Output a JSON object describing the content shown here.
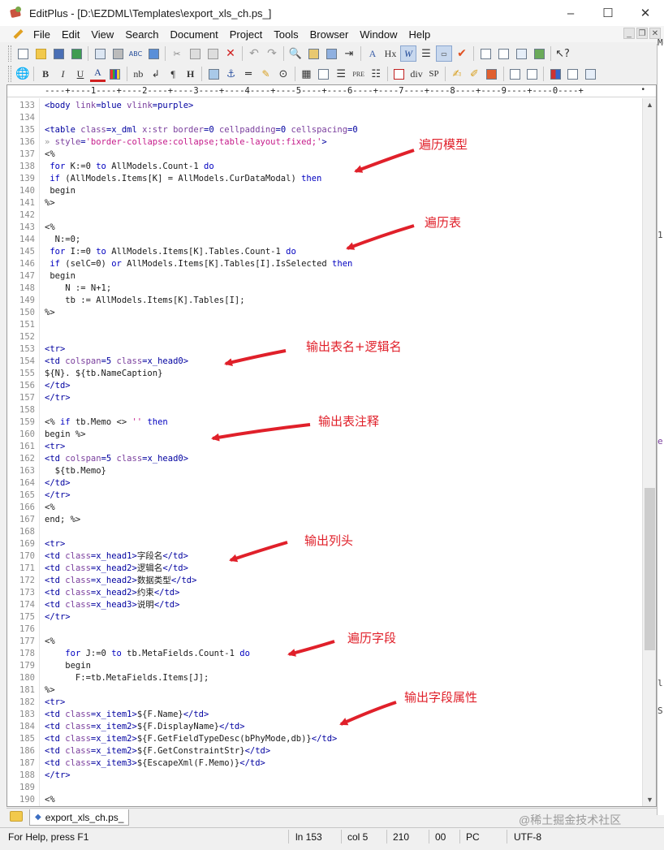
{
  "window": {
    "title": "EditPlus - [D:\\EZDML\\Templates\\export_xls_ch.ps_]"
  },
  "window_buttons": {
    "minimize": "–",
    "maximize": "☐",
    "close": "✕"
  },
  "menu": [
    "File",
    "Edit",
    "View",
    "Search",
    "Document",
    "Project",
    "Tools",
    "Browser",
    "Window",
    "Help"
  ],
  "mdi_buttons": [
    "_",
    "❐",
    "✕"
  ],
  "toolbar2_text": {
    "bold": "B",
    "italic": "I",
    "underline": "U",
    "font_color": "A",
    "nbsp": "nb",
    "paragraph": "¶",
    "heading": "H",
    "pre": "PRE",
    "div": "div",
    "span": "SP"
  },
  "toolbar1_text": {
    "hx": "Hx",
    "w": "W",
    "spell": "ABC"
  },
  "ruler": "----+----1----+----2----+----3----+----4----+----5----+----6----+----7----+----8----+----9----+----0----+",
  "right_strip_chars": [
    "1",
    "e",
    "l",
    "S",
    "M"
  ],
  "colors": {
    "tag": "#0000a0",
    "attr": "#7a3e9d",
    "value": "#c51b8a",
    "keyword": "#0000c0",
    "annotation": "#e0202a"
  },
  "code_lines": [
    {
      "n": "133",
      "t": [
        [
          "<body ",
          "tag"
        ],
        [
          "link",
          "attr"
        ],
        [
          "=blue ",
          "tag"
        ],
        [
          "vlink",
          "attr"
        ],
        [
          "=purple>",
          "tag"
        ]
      ]
    },
    {
      "n": "134",
      "t": []
    },
    {
      "n": "135",
      "t": [
        [
          "<table ",
          "tag"
        ],
        [
          "class",
          "attr"
        ],
        [
          "=x_dml ",
          "tag"
        ],
        [
          "x:str ",
          "attr"
        ],
        [
          "border",
          "attr"
        ],
        [
          "=0 ",
          "tag"
        ],
        [
          "cellpadding",
          "attr"
        ],
        [
          "=0 ",
          "tag"
        ],
        [
          "cellspacing",
          "attr"
        ],
        [
          "=0",
          "tag"
        ]
      ]
    },
    {
      "n": "136",
      "t": [
        [
          "» ",
          "gray"
        ],
        [
          "style",
          "attr"
        ],
        [
          "=",
          "tag"
        ],
        [
          "'border-collapse:collapse;table-layout:fixed;'",
          "value"
        ],
        [
          ">",
          "tag"
        ]
      ]
    },
    {
      "n": "137",
      "t": [
        [
          "<%",
          "dark"
        ]
      ]
    },
    {
      "n": "138",
      "t": [
        [
          " ",
          "dark"
        ],
        [
          "for ",
          "keyword"
        ],
        [
          "K:=0 ",
          "dark"
        ],
        [
          "to ",
          "keyword"
        ],
        [
          "AllModels.Count-1 ",
          "dark"
        ],
        [
          "do",
          "keyword"
        ]
      ]
    },
    {
      "n": "139",
      "t": [
        [
          " ",
          "dark"
        ],
        [
          "if ",
          "keyword"
        ],
        [
          "(AllModels.Items[K] = AllModels.CurDataModal) ",
          "dark"
        ],
        [
          "then",
          "keyword"
        ]
      ]
    },
    {
      "n": "140",
      "t": [
        [
          " begin",
          "dark"
        ]
      ]
    },
    {
      "n": "141",
      "t": [
        [
          "%>",
          "dark"
        ]
      ]
    },
    {
      "n": "142",
      "t": []
    },
    {
      "n": "143",
      "t": [
        [
          "<%",
          "dark"
        ]
      ]
    },
    {
      "n": "144",
      "t": [
        [
          "  N:=0;",
          "dark"
        ]
      ]
    },
    {
      "n": "145",
      "t": [
        [
          " ",
          "dark"
        ],
        [
          "for ",
          "keyword"
        ],
        [
          "I:=0 ",
          "dark"
        ],
        [
          "to ",
          "keyword"
        ],
        [
          "AllModels.Items[K].Tables.Count-1 ",
          "dark"
        ],
        [
          "do",
          "keyword"
        ]
      ]
    },
    {
      "n": "146",
      "t": [
        [
          " ",
          "dark"
        ],
        [
          "if ",
          "keyword"
        ],
        [
          "(selC=0) ",
          "dark"
        ],
        [
          "or ",
          "keyword"
        ],
        [
          "AllModels.Items[K].Tables[I].IsSelected ",
          "dark"
        ],
        [
          "then",
          "keyword"
        ]
      ]
    },
    {
      "n": "147",
      "t": [
        [
          " begin",
          "dark"
        ]
      ]
    },
    {
      "n": "148",
      "t": [
        [
          "    N := N+1;",
          "dark"
        ]
      ]
    },
    {
      "n": "149",
      "t": [
        [
          "    tb := AllModels.Items[K].Tables[I];",
          "dark"
        ]
      ]
    },
    {
      "n": "150",
      "t": [
        [
          "%>",
          "dark"
        ]
      ]
    },
    {
      "n": "151",
      "t": []
    },
    {
      "n": "152",
      "t": []
    },
    {
      "n": "153",
      "t": [
        [
          "<tr>",
          "tag"
        ]
      ]
    },
    {
      "n": "154",
      "t": [
        [
          "<td ",
          "tag"
        ],
        [
          "colspan",
          "attr"
        ],
        [
          "=5 ",
          "tag"
        ],
        [
          "class",
          "attr"
        ],
        [
          "=x_head0>",
          "tag"
        ]
      ]
    },
    {
      "n": "155",
      "t": [
        [
          "${N}. ${tb.NameCaption}",
          "dark"
        ]
      ]
    },
    {
      "n": "156",
      "t": [
        [
          "</td>",
          "tag"
        ]
      ]
    },
    {
      "n": "157",
      "t": [
        [
          "</tr>",
          "tag"
        ]
      ]
    },
    {
      "n": "158",
      "t": []
    },
    {
      "n": "159",
      "t": [
        [
          "<% ",
          "dark"
        ],
        [
          "if ",
          "keyword"
        ],
        [
          "tb.Memo <> ",
          "dark"
        ],
        [
          "'' ",
          "value"
        ],
        [
          "then",
          "keyword"
        ]
      ]
    },
    {
      "n": "160",
      "t": [
        [
          "begin %>",
          "dark"
        ]
      ]
    },
    {
      "n": "161",
      "t": [
        [
          "<tr>",
          "tag"
        ]
      ]
    },
    {
      "n": "162",
      "t": [
        [
          "<td ",
          "tag"
        ],
        [
          "colspan",
          "attr"
        ],
        [
          "=5 ",
          "tag"
        ],
        [
          "class",
          "attr"
        ],
        [
          "=x_head0>",
          "tag"
        ]
      ]
    },
    {
      "n": "163",
      "t": [
        [
          "  ${tb.Memo}",
          "dark"
        ]
      ]
    },
    {
      "n": "164",
      "t": [
        [
          "</td>",
          "tag"
        ]
      ]
    },
    {
      "n": "165",
      "t": [
        [
          "</tr>",
          "tag"
        ]
      ]
    },
    {
      "n": "166",
      "t": [
        [
          "<%",
          "dark"
        ]
      ]
    },
    {
      "n": "167",
      "t": [
        [
          "end; %>",
          "dark"
        ]
      ]
    },
    {
      "n": "168",
      "t": []
    },
    {
      "n": "169",
      "t": [
        [
          "<tr>",
          "tag"
        ]
      ]
    },
    {
      "n": "170",
      "t": [
        [
          "<td ",
          "tag"
        ],
        [
          "class",
          "attr"
        ],
        [
          "=x_head1>",
          "tag"
        ],
        [
          "字段名",
          "dark"
        ],
        [
          "</td>",
          "tag"
        ]
      ]
    },
    {
      "n": "171",
      "t": [
        [
          "<td ",
          "tag"
        ],
        [
          "class",
          "attr"
        ],
        [
          "=x_head2>",
          "tag"
        ],
        [
          "逻辑名",
          "dark"
        ],
        [
          "</td>",
          "tag"
        ]
      ]
    },
    {
      "n": "172",
      "t": [
        [
          "<td ",
          "tag"
        ],
        [
          "class",
          "attr"
        ],
        [
          "=x_head2>",
          "tag"
        ],
        [
          "数据类型",
          "dark"
        ],
        [
          "</td>",
          "tag"
        ]
      ]
    },
    {
      "n": "173",
      "t": [
        [
          "<td ",
          "tag"
        ],
        [
          "class",
          "attr"
        ],
        [
          "=x_head2>",
          "tag"
        ],
        [
          "约束",
          "dark"
        ],
        [
          "</td>",
          "tag"
        ]
      ]
    },
    {
      "n": "174",
      "t": [
        [
          "<td ",
          "tag"
        ],
        [
          "class",
          "attr"
        ],
        [
          "=x_head3>",
          "tag"
        ],
        [
          "说明",
          "dark"
        ],
        [
          "</td>",
          "tag"
        ]
      ]
    },
    {
      "n": "175",
      "t": [
        [
          "</tr>",
          "tag"
        ]
      ]
    },
    {
      "n": "176",
      "t": []
    },
    {
      "n": "177",
      "t": [
        [
          "<%",
          "dark"
        ]
      ]
    },
    {
      "n": "178",
      "t": [
        [
          "    ",
          "dark"
        ],
        [
          "for ",
          "keyword"
        ],
        [
          "J:=0 ",
          "dark"
        ],
        [
          "to ",
          "keyword"
        ],
        [
          "tb.MetaFields.Count-1 ",
          "dark"
        ],
        [
          "do",
          "keyword"
        ]
      ]
    },
    {
      "n": "179",
      "t": [
        [
          "    begin",
          "dark"
        ]
      ]
    },
    {
      "n": "180",
      "t": [
        [
          "      F:=tb.MetaFields.Items[J];",
          "dark"
        ]
      ]
    },
    {
      "n": "181",
      "t": [
        [
          "%>",
          "dark"
        ]
      ]
    },
    {
      "n": "182",
      "t": [
        [
          "<tr>",
          "tag"
        ]
      ]
    },
    {
      "n": "183",
      "t": [
        [
          "<td ",
          "tag"
        ],
        [
          "class",
          "attr"
        ],
        [
          "=x_item1>",
          "tag"
        ],
        [
          "${F.Name}",
          "dark"
        ],
        [
          "</td>",
          "tag"
        ]
      ]
    },
    {
      "n": "184",
      "t": [
        [
          "<td ",
          "tag"
        ],
        [
          "class",
          "attr"
        ],
        [
          "=x_item2>",
          "tag"
        ],
        [
          "${F.DisplayName}",
          "dark"
        ],
        [
          "</td>",
          "tag"
        ]
      ]
    },
    {
      "n": "185",
      "t": [
        [
          "<td ",
          "tag"
        ],
        [
          "class",
          "attr"
        ],
        [
          "=x_item2>",
          "tag"
        ],
        [
          "${F.GetFieldTypeDesc(bPhyMode,db)}",
          "dark"
        ],
        [
          "</td>",
          "tag"
        ]
      ]
    },
    {
      "n": "186",
      "t": [
        [
          "<td ",
          "tag"
        ],
        [
          "class",
          "attr"
        ],
        [
          "=x_item2>",
          "tag"
        ],
        [
          "${F.GetConstraintStr}",
          "dark"
        ],
        [
          "</td>",
          "tag"
        ]
      ]
    },
    {
      "n": "187",
      "t": [
        [
          "<td ",
          "tag"
        ],
        [
          "class",
          "attr"
        ],
        [
          "=x_item3>",
          "tag"
        ],
        [
          "${EscapeXml(F.Memo)}",
          "dark"
        ],
        [
          "</td>",
          "tag"
        ]
      ]
    },
    {
      "n": "188",
      "t": [
        [
          "</tr>",
          "tag"
        ]
      ]
    },
    {
      "n": "189",
      "t": []
    },
    {
      "n": "190",
      "t": [
        [
          "<%",
          "dark"
        ]
      ]
    }
  ],
  "annotations": [
    "遍历模型",
    "遍历表",
    "输出表名+逻辑名",
    "输出表注释",
    "输出列头",
    "遍历字段",
    "输出字段属性"
  ],
  "tab": {
    "label": "export_xls_ch.ps_"
  },
  "watermark": "@稀土掘金技术社区",
  "status": {
    "help": "For Help, press F1",
    "line": "ln 153",
    "col": "col 5",
    "num": "210",
    "ins": "00",
    "eol": "PC",
    "encoding": "UTF-8"
  }
}
